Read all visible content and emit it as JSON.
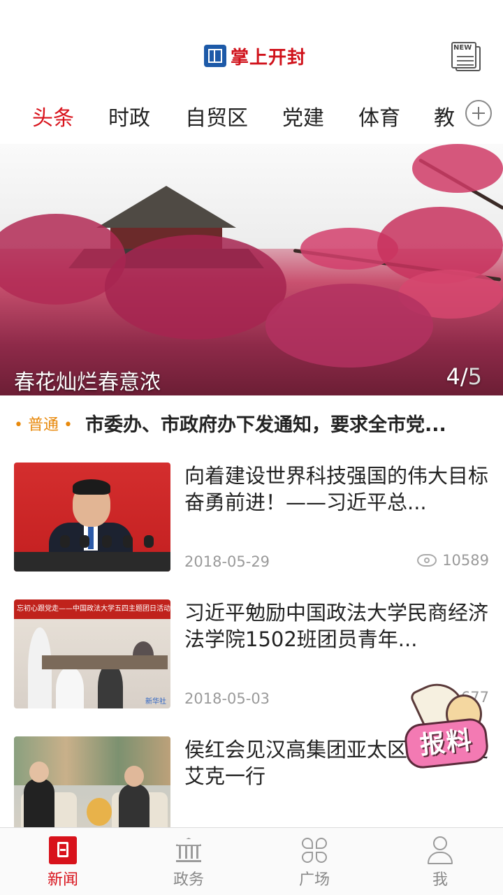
{
  "header": {
    "app_title": "掌上开封",
    "news_button_tag": "NEW"
  },
  "tabs": [
    {
      "label": "头条",
      "active": true
    },
    {
      "label": "时政",
      "active": false
    },
    {
      "label": "自贸区",
      "active": false
    },
    {
      "label": "党建",
      "active": false
    },
    {
      "label": "体育",
      "active": false
    },
    {
      "label": "教",
      "active": false
    }
  ],
  "banner": {
    "title": "春花灿烂春意浓",
    "current_page": "4",
    "separator": "/",
    "total_pages": "5"
  },
  "notice": {
    "tag": "• 普通 •",
    "text": "市委办、市政府办下发通知，要求全市党..."
  },
  "articles": [
    {
      "title": "向着建设世界科技强国的伟大目标奋勇前进！——习近平总...",
      "date": "2018-05-29",
      "views": "10589"
    },
    {
      "title": "习近平勉励中国政法大学民商经济法学院1502班团员青年...",
      "date": "2018-05-03",
      "views": "677",
      "thumb_banner": "忘初心跟党走——中国政法大学五四主题团日活动",
      "thumb_logo": "新华社"
    },
    {
      "title": "侯红会见汉高集团亚太区财务官史艾克一行",
      "date": "",
      "views": ""
    }
  ],
  "badge": {
    "label": "报料"
  },
  "bottom_nav": [
    {
      "label": "新闻",
      "icon": "news-icon",
      "active": true
    },
    {
      "label": "政务",
      "icon": "government-icon",
      "active": false
    },
    {
      "label": "广场",
      "icon": "plaza-icon",
      "active": false
    },
    {
      "label": "我",
      "icon": "profile-icon",
      "active": false
    }
  ],
  "colors": {
    "accent": "#d8121b",
    "notice_tag": "#e8890c",
    "muted_text": "#9a9a9a"
  }
}
